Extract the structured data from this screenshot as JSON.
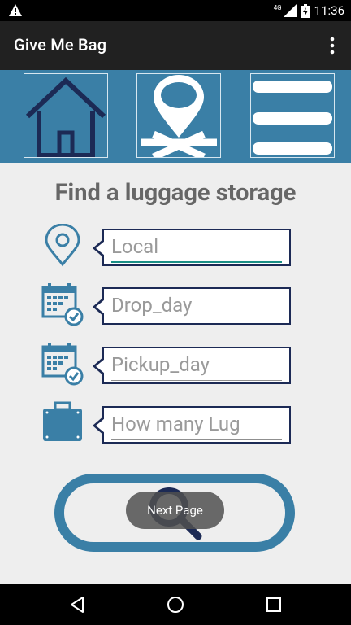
{
  "status_bar": {
    "time": "11:36",
    "network": "4G"
  },
  "app_bar": {
    "title": "Give Me Bag"
  },
  "heading": "Find a luggage storage",
  "fields": {
    "local": {
      "placeholder": "Local"
    },
    "drop_day": {
      "placeholder": "Drop_day"
    },
    "pickup_day": {
      "placeholder": "Pickup_day"
    },
    "luggage_count": {
      "placeholder": "How many Lug"
    }
  },
  "toast": {
    "text": "Next Page"
  },
  "colors": {
    "accent": "#3a7fa6",
    "dark_navy": "#1c2a55",
    "app_bar": "#212121",
    "input_focus": "#1a8f86"
  },
  "icons": [
    "warning-icon",
    "signal-icon",
    "battery-icon",
    "overflow-menu-icon",
    "home-icon",
    "map-pin-icon",
    "hamburger-menu-icon",
    "location-pin-icon",
    "calendar-check-icon",
    "suitcase-icon",
    "magnifier-icon",
    "back-icon",
    "home-circle-icon",
    "recents-icon"
  ]
}
